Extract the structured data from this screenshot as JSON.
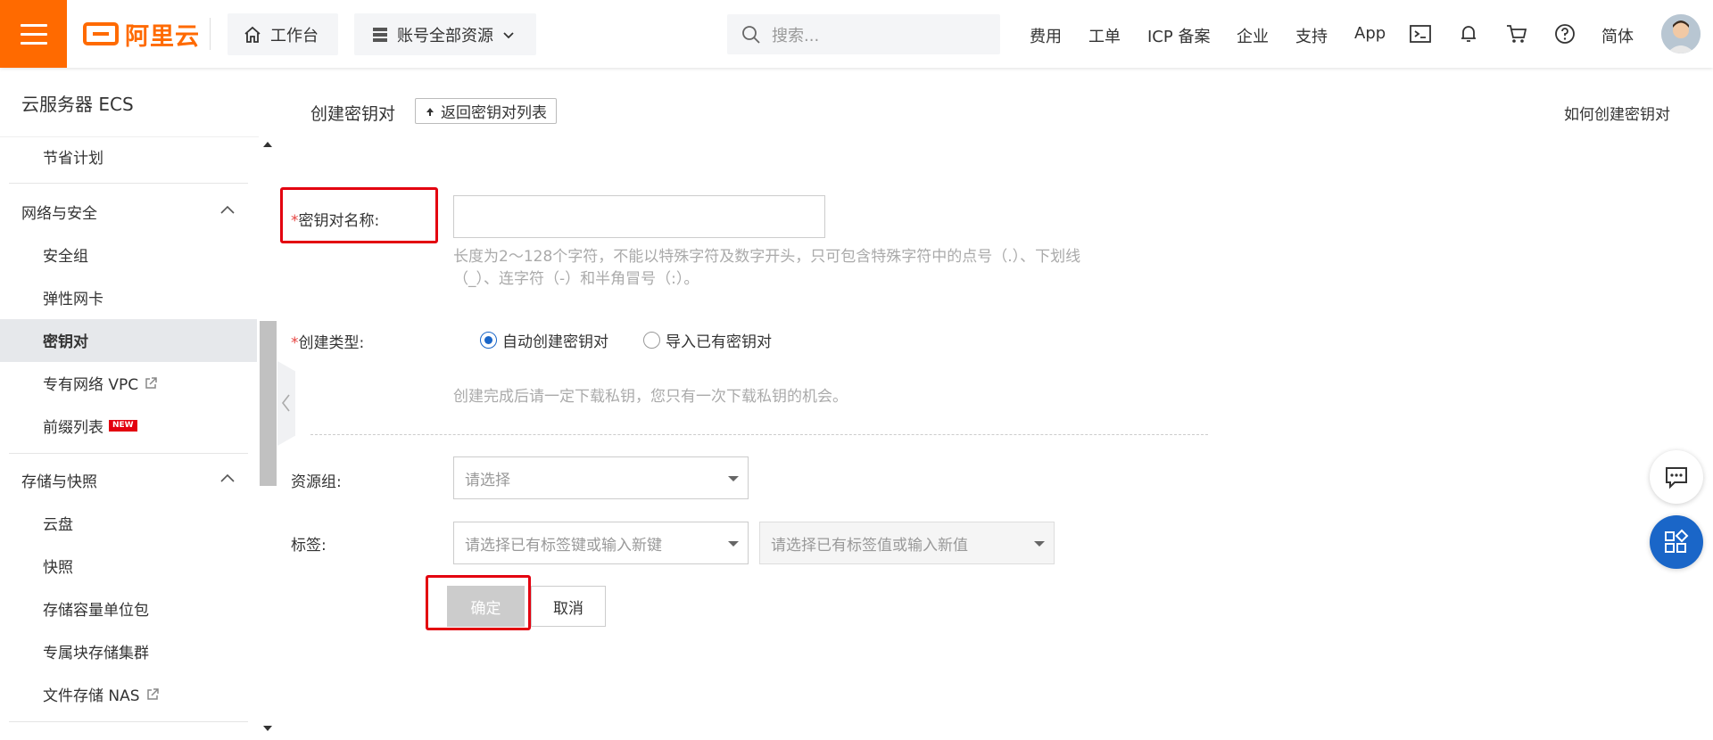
{
  "topbar": {
    "logo_text": "阿里云",
    "workbench": "工作台",
    "resources": "账号全部资源",
    "search_placeholder": "搜索...",
    "links": [
      "费用",
      "工单",
      "ICP 备案",
      "企业",
      "支持",
      "App"
    ],
    "language": "简体",
    "brand_color": "#ff6a00"
  },
  "sidebar": {
    "title": "云服务器 ECS",
    "items": {
      "savings_plan": "节省计划",
      "group_network": "网络与安全",
      "security_group": "安全组",
      "eni": "弹性网卡",
      "key_pair": "密钥对",
      "vpc": "专有网络 VPC",
      "prefix_list": "前缀列表",
      "new_badge": "NEW",
      "group_storage": "存储与快照",
      "cloud_disk": "云盘",
      "snapshot": "快照",
      "storage_pack": "存储容量单位包",
      "dedicated_block": "专属块存储集群",
      "nas": "文件存储 NAS"
    }
  },
  "main": {
    "page_title": "创建密钥对",
    "back_link": "返回密钥对列表",
    "help_link": "如何创建密钥对",
    "form": {
      "name_label": "密钥对名称:",
      "name_value": "",
      "name_hint_line1": "长度为2～128个字符，不能以特殊字符及数字开头，只可包含特殊字符中的点号（.）、下划线",
      "name_hint_line2": "（_）、连字符（-）和半角冒号（:）。",
      "type_label": "创建类型:",
      "type_auto": "自动创建密钥对",
      "type_import": "导入已有密钥对",
      "type_selected": "自动创建密钥对",
      "type_hint": "创建完成后请一定下载私钥，您只有一次下载私钥的机会。",
      "resource_group_label": "资源组:",
      "resource_group_placeholder": "请选择",
      "tag_label": "标签:",
      "tag_key_placeholder": "请选择已有标签键或输入新键",
      "tag_value_placeholder": "请选择已有标签值或输入新值",
      "required_mark": "*",
      "confirm": "确定",
      "cancel": "取消"
    }
  }
}
